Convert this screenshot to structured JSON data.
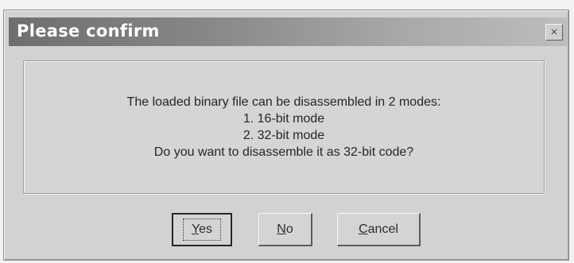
{
  "dialog": {
    "title": "Please confirm",
    "close_glyph": "×",
    "message_lines": [
      "The loaded binary file can be disassembled in 2 modes:",
      "1. 16-bit mode",
      "2. 32-bit mode",
      "Do you want to disassemble it as 32-bit code?"
    ],
    "buttons": {
      "yes": {
        "mnemonic": "Y",
        "rest": "es"
      },
      "no": {
        "mnemonic": "N",
        "rest": "o"
      },
      "cancel": {
        "mnemonic": "C",
        "rest": "ancel"
      }
    },
    "default_button": "yes"
  }
}
